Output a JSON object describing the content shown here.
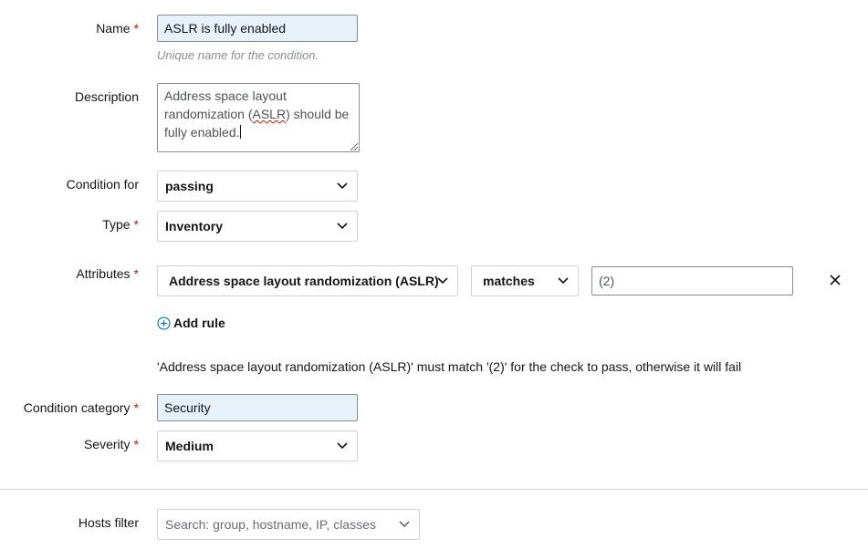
{
  "form": {
    "name": {
      "label": "Name",
      "value": "ASLR is fully enabled",
      "helper": "Unique name for the condition."
    },
    "description": {
      "label": "Description",
      "line1": "Address space layout",
      "line2_pre": "randomization (",
      "line2_word": "ASLR",
      "line2_post": ") should be",
      "line3": "fully enabled."
    },
    "condition_for": {
      "label": "Condition for",
      "value": "passing"
    },
    "type": {
      "label": "Type",
      "value": "Inventory"
    },
    "attributes": {
      "label": "Attributes",
      "attribute": "Address space layout randomization (ASLR)",
      "operator": "matches",
      "value": "(2)",
      "add_rule": "Add rule",
      "summary": "'Address space layout randomization (ASLR)' must match '(2)' for the check to pass, otherwise it will fail"
    },
    "condition_category": {
      "label": "Condition category",
      "value": "Security"
    },
    "severity": {
      "label": "Severity",
      "value": "Medium"
    },
    "hosts_filter": {
      "label": "Hosts filter",
      "placeholder": "Search: group, hostname, IP, classes"
    }
  },
  "required_marker": "*",
  "icons": [
    "chevron-down-icon",
    "plus-circle-icon",
    "close-icon",
    "resize-handle-icon"
  ],
  "colors": {
    "required": "#c9190b",
    "filled_bg": "#e7f1fa",
    "border": "#8a8d90",
    "helper": "#8a8d90"
  }
}
